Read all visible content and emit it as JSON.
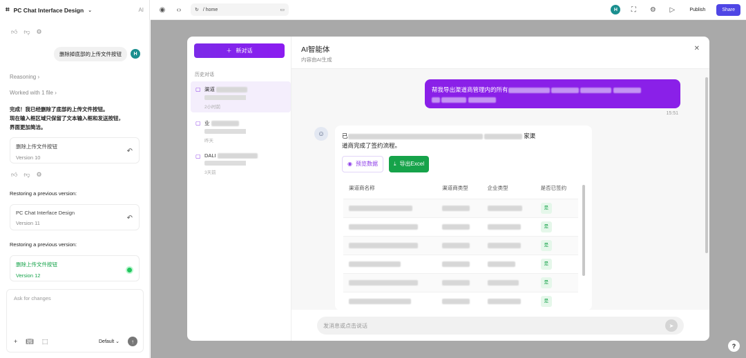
{
  "left": {
    "project_title": "PC Chat Interface Design",
    "ai_label": "AI",
    "user_message": "删除掉底部的上传文件按钮",
    "user_avatar": "H",
    "reasoning": "Reasoning",
    "worked_with": "Worked with 1 file",
    "reply_lines": [
      "完成！我已经删除了底部的上传文件按钮。",
      "现在输入框区域只保留了文本输入框和发送按钮，",
      "界面更加简洁。"
    ],
    "versions": [
      {
        "title": "删除上传文件按钮",
        "version": "Version 10"
      },
      {
        "title": "PC Chat Interface Design",
        "version": "Version 11"
      },
      {
        "title": "删除上传文件按钮",
        "version": "Version 12"
      }
    ],
    "restoring_1": "Restoring a previous version:",
    "restoring_2": "Restoring a previous version:",
    "composer_placeholder": "Ask for changes",
    "composer_mode": "Default"
  },
  "topbar": {
    "url": "/ home",
    "avatar": "H",
    "publish": "Publish",
    "share": "Share"
  },
  "modal": {
    "new_chat": "新对话",
    "history_title": "历史对话",
    "conversations": [
      {
        "title": "渠道",
        "time": "2小时前"
      },
      {
        "title": "业",
        "time": "昨天"
      },
      {
        "title": "DALI",
        "time": "3天前"
      }
    ],
    "title": "AI智能体",
    "subtitle": "内容由AI生成",
    "user_msg_prefix": "帮我导出渠道商管理内的所有",
    "user_msg_time": "15:51",
    "bot_prefix": "已",
    "bot_mid": "家渠",
    "bot_line2": "道商完成了签约流程。",
    "view_label": "预览数据",
    "export_label": "导出Excel",
    "table": {
      "headers": [
        "渠道商名称",
        "渠道商类型",
        "企业类型",
        "是否已签约"
      ],
      "rows": [
        {
          "signed": "是"
        },
        {
          "signed": "是"
        },
        {
          "signed": "是"
        },
        {
          "signed": "是"
        },
        {
          "signed": "是"
        },
        {
          "signed": "是"
        }
      ]
    },
    "input_placeholder": "发消息或点击说话"
  },
  "colors": {
    "accent": "#8a20e8",
    "share": "#4f46e5",
    "excel": "#16a34a",
    "avatar": "#1a8f8f"
  }
}
